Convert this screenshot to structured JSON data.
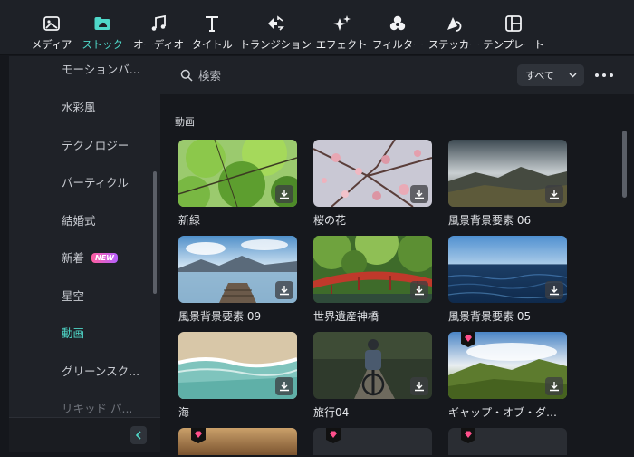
{
  "toolbar": {
    "items": [
      {
        "label": "メディア",
        "icon": "media-icon",
        "active": false
      },
      {
        "label": "ストック",
        "icon": "stock-folder-icon",
        "active": true
      },
      {
        "label": "オーディオ",
        "icon": "music-note-icon",
        "active": false
      },
      {
        "label": "タイトル",
        "icon": "title-t-icon",
        "active": false
      },
      {
        "label": "トランジション",
        "icon": "transition-icon",
        "active": false
      },
      {
        "label": "エフェクト",
        "icon": "effect-star-icon",
        "active": false
      },
      {
        "label": "フィルター",
        "icon": "filter-circles-icon",
        "active": false
      },
      {
        "label": "ステッカー",
        "icon": "sticker-icon",
        "active": false
      },
      {
        "label": "テンプレート",
        "icon": "template-icon",
        "active": false
      }
    ],
    "accent_color": "#4fd8c9"
  },
  "sidebar": {
    "items": [
      {
        "label": "モーションバ..."
      },
      {
        "label": "水彩風"
      },
      {
        "label": "テクノロジー"
      },
      {
        "label": "パーティクル"
      },
      {
        "label": "結婚式"
      },
      {
        "label": "新着",
        "badge": "NEW"
      },
      {
        "label": "星空"
      },
      {
        "label": "動画",
        "active": true
      },
      {
        "label": "グリーンスク..."
      },
      {
        "label": "リキッド パ..."
      }
    ],
    "collapse_icon": "chevron-left-icon"
  },
  "search": {
    "placeholder": "検索",
    "filter_value": "すべて"
  },
  "section": {
    "title": "動画"
  },
  "cards": [
    {
      "title": "新緑",
      "premium": false
    },
    {
      "title": "桜の花",
      "premium": false
    },
    {
      "title": "風景背景要素 06",
      "premium": false
    },
    {
      "title": "風景背景要素 09",
      "premium": false
    },
    {
      "title": "世界遺産神橋",
      "premium": false
    },
    {
      "title": "風景背景要素 05",
      "premium": false
    },
    {
      "title": "海",
      "premium": false
    },
    {
      "title": "旅行04",
      "premium": false
    },
    {
      "title": "ギャップ・オブ・ダン...",
      "premium": true
    }
  ]
}
